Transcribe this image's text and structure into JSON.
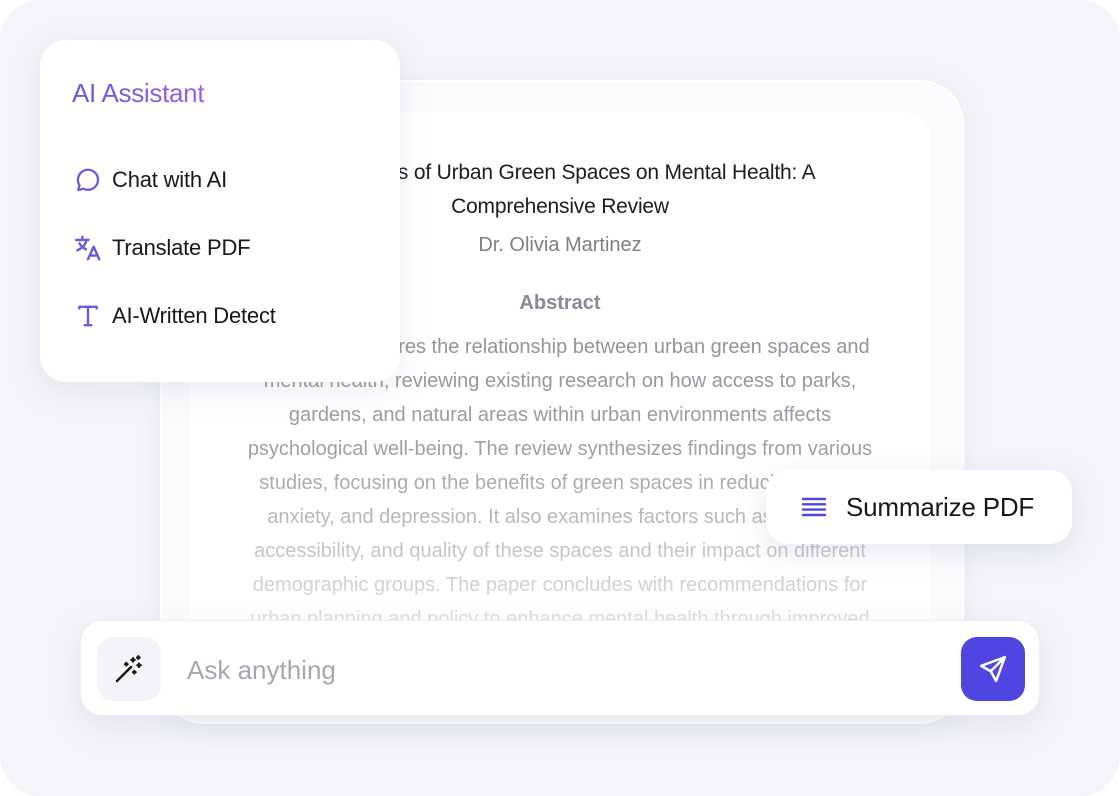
{
  "assistant": {
    "title": "AI Assistant",
    "items": [
      {
        "label": "Chat with AI",
        "icon": "chat-bubble-icon"
      },
      {
        "label": "Translate PDF",
        "icon": "translate-icon"
      },
      {
        "label": "AI-Written Detect",
        "icon": "text-t-icon"
      }
    ]
  },
  "document": {
    "title_line1": "The Effects of Urban Green Spaces on Mental Health: A",
    "title_line2": "Comprehensive Review",
    "author": "Dr. Olivia Martinez",
    "abstract_heading": "Abstract",
    "abstract_text": "This paper explores the relationship between urban green spaces and mental health, reviewing existing research on how access to parks, gardens, and natural areas within urban environments affects psychological well-being. The review synthesizes findings from various studies, focusing on the benefits of green spaces in reducing stress, anxiety, and depression. It also examines factors such as the size, accessibility, and quality of these spaces and their impact on different demographic groups. The paper concludes with recommendations for urban planning and policy to enhance mental health through improved"
  },
  "summarize": {
    "label": "Summarize PDF",
    "icon": "list-lines-icon"
  },
  "ask_bar": {
    "placeholder": "Ask anything",
    "value": "",
    "magic_icon": "magic-wand-icon",
    "send_icon": "send-icon"
  },
  "colors": {
    "accent": "#4f45e0",
    "title_gradient_start": "#5b5be2",
    "title_gradient_end": "#9b5ef0",
    "icon_purple": "#6a5ae0"
  }
}
